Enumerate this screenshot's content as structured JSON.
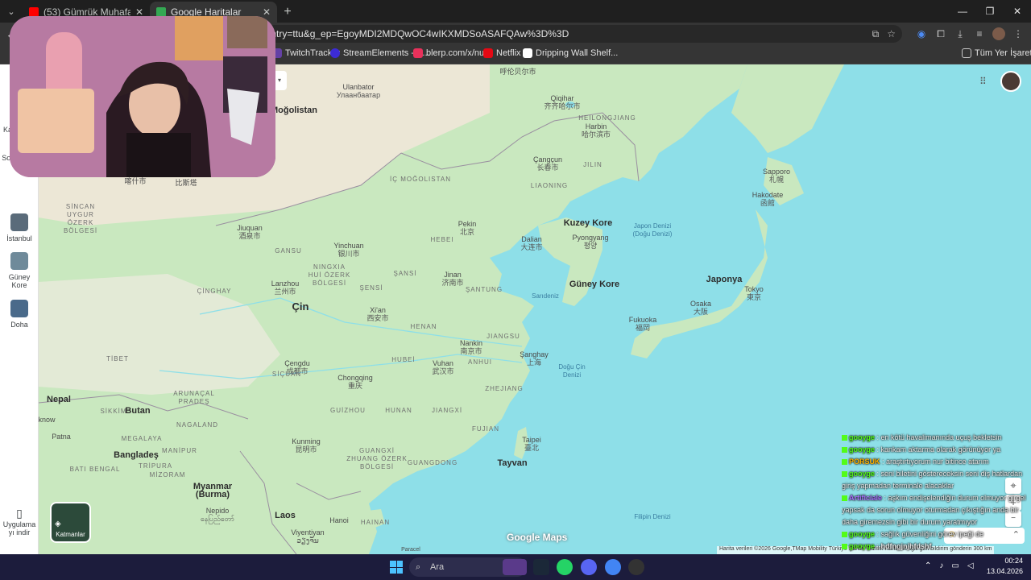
{
  "browser": {
    "tabs": [
      {
        "title": "(53) Gümrük Muhafaza Türkiye",
        "favicon_color": "#ff0000",
        "active": false
      },
      {
        "title": "Google Haritalar",
        "favicon_color": "#34a853",
        "active": true
      }
    ],
    "url": "?entry=ttu&g_ep=EgoyMDI2MDQwOC4wIKXMDSoASAFQAw%3D%3D",
    "bookmarks": [
      {
        "label": "TwitchTracker",
        "color": "#6441a5"
      },
      {
        "label": "StreamElements - S...",
        "color": "#3c2bd4"
      },
      {
        "label": "blerp.com/x/nurr",
        "color": "#e8315b"
      },
      {
        "label": "Netflix",
        "color": "#e50914"
      },
      {
        "label": "Dripping Wall Shelf...",
        "color": "#ffffff"
      }
    ],
    "all_bookmarks": "Tüm Yer İşaretleri"
  },
  "sidebar": {
    "partial_label": "Ka",
    "recent": "Son öğeler",
    "items": [
      {
        "label": "İstanbul",
        "color": "#5a6b7a"
      },
      {
        "label": "Güney Kore",
        "color": "#6f8a9a"
      },
      {
        "label": "Doha",
        "color": "#4a6a8a"
      }
    ],
    "get_app": "Uygulama yı indir"
  },
  "map": {
    "labels": {
      "hulunbuir": "呼伦贝尔市",
      "ulanbator": "Ulanbator",
      "ulanbator_mn": "Улаанбаатар",
      "mogolistan": "Moğolistan",
      "qiqihar": "Qiqihar",
      "qiqihar_cn": "齐齐哈尔市",
      "harbin": "Harbin",
      "harbin_cn": "哈尔滨市",
      "heilongjiang": "HEILONGJIANG",
      "cangcun": "Çangçun",
      "cangcun_cn": "长春市",
      "jilin": "JILIN",
      "ic_mogolistan": "İÇ MOĞOLISTAN",
      "liaoning": "LIAONING",
      "sapporo": "Sapporo",
      "sapporo_jp": "札幌",
      "hakodate": "Hakodate",
      "hakodate_jp": "函館",
      "uygur": "SİNCAN\nUYGUR\nÖZERK\nBÖLGESİ",
      "jiuquan": "Jiuquan",
      "jiuquan_cn": "酒泉市",
      "pekin": "Pekin",
      "pekin_cn": "北京",
      "hebei": "HEBEI",
      "dalian": "Dalian",
      "dalian_cn": "大连市",
      "kuzey_kore": "Kuzey Kore",
      "pyongyang": "Pyongyang",
      "pyongyang_kr": "평양",
      "japon_denizi": "Japon Denizi\n(Doğu Denizi)",
      "yinchuan": "Yinchuan",
      "yinchuan_cn": "银川市",
      "gansu": "GANSU",
      "ningxia": "NINGXIA\nHUİ ÖZERK\nBÖLGESİ",
      "sansi": "ŞANSİ",
      "jinan": "Jinan",
      "jinan_cn": "济南市",
      "santung": "ŞANTUNG",
      "guney_kore": "Güney Kore",
      "japonya": "Japonya",
      "tokyo": "Tokyo",
      "tokyo_jp": "東京",
      "lanzhou": "Lanzhou",
      "lanzhou_cn": "兰州市",
      "cinghay": "ÇİNGHAY",
      "sensi": "ŞENSİ",
      "cin": "Çin",
      "xian": "Xi'an",
      "xian_cn": "西安市",
      "henan": "HENAN",
      "sarideniz": "Sarıdeniz",
      "osaka": "Osaka",
      "osaka_jp": "大阪",
      "fukuoka": "Fukuoka",
      "fukuoka_jp": "福岡",
      "jiangsu": "JIANGSU",
      "nankin": "Nankin",
      "nankin_cn": "南京市",
      "sanghay": "Şanghay",
      "sanghay_cn": "上海",
      "tibet": "TİBET",
      "cengdu": "Çengdu",
      "cengdu_cn": "成都市",
      "sicuan": "SİÇUAN",
      "hubei": "HUBEİ",
      "vuhan": "Vuhan",
      "vuhan_cn": "武汉市",
      "anhui": "ANHUI",
      "dogu_cin_denizi": "Doğu Çin\nDenizi",
      "chongqing": "Chongqing",
      "chongqing_cn": "重庆",
      "zhejiang": "ZHEJIANG",
      "nepal": "Nepal",
      "arunacal": "ARUNAÇAL\nPRADEŞ",
      "sikkim": "SİKKİM",
      "butan": "Butan",
      "guizhou": "GUİZHOU",
      "hunan": "HUNAN",
      "jiangxi": "JIANGXİ",
      "fujian": "FUJIAN",
      "know": "know",
      "patna": "Patna",
      "nagaland": "NAGALAND",
      "megalaya": "MEGALAYA",
      "manipur": "MANİPUR",
      "taipei": "Taipei",
      "taipei_cn": "臺北",
      "bangladesh": "Bangladeş",
      "tripura": "TRİPURA",
      "kunming": "Kunming",
      "kunming_cn": "昆明市",
      "guangxi": "GUANGXİ\nZHUANG ÖZERK\nBÖLGESİ",
      "guangdong": "GUANGDONG",
      "tayvan": "Tayvan",
      "bati_bengal": "BATI BENGAL",
      "mizoram": "MİZORAM",
      "myanmar": "Myanmar\n(Burma)",
      "hanoi": "Hanoi",
      "laos": "Laos",
      "hainan": "HAINAN",
      "filipin_denizi": "Filipin Denizi",
      "nepido": "Nepido",
      "nepido_mm": "နေပြည်တော်",
      "viyentiyan": "Viyentiyan",
      "viyentiyan_la": "ວຽງຈັນ",
      "paracel": "Paracel",
      "karachi_stub": "比斯塔",
      "kurla_stub": "喀什市"
    },
    "layers_label": "Katmanlar",
    "logo": "Google Maps",
    "attribution": "Harita verileri ©2026 Google,TMap Mobility   Türkiye  Şartlar  Gizlilik  Harita ile ilgili geri bildirim gönderin  300 km"
  },
  "chat": [
    {
      "user": "gooyge",
      "text": "en kötü havalimanında uçuş bekletsin",
      "color": "#53fc18"
    },
    {
      "user": "gooyge",
      "text": "kankam aktarma olarak görünüyor ya",
      "color": "#53fc18"
    },
    {
      "user": "PORSUK",
      "text": "araştırtıyorum nur bitince atarım",
      "color": "#ffb300"
    },
    {
      "user": "gooyge",
      "text": "seni biletini göstereceksin seni diş hatlardan giriş yapmadan terminale alacaklar",
      "color": "#53fc18"
    },
    {
      "user": "Artificiale",
      "text": "aşkım endişelendiğin durum olmuyor girgel yapsak da sorun olmuyor oturmadan çıkıştığın anda bir daha giremezsin gibi bir durum yaratmıyor",
      "color": "#a970ff"
    },
    {
      "user": "gooyge",
      "text": "sağlık güvenliğini görev ipeği de",
      "color": "#53fc18"
    },
    {
      "user": "gooyge",
      "text": "hdfngjnjhfdshf",
      "color": "#53fc18"
    }
  ],
  "taskbar": {
    "search_placeholder": "Ara",
    "time": "00:24",
    "date": "13.04.2026"
  }
}
